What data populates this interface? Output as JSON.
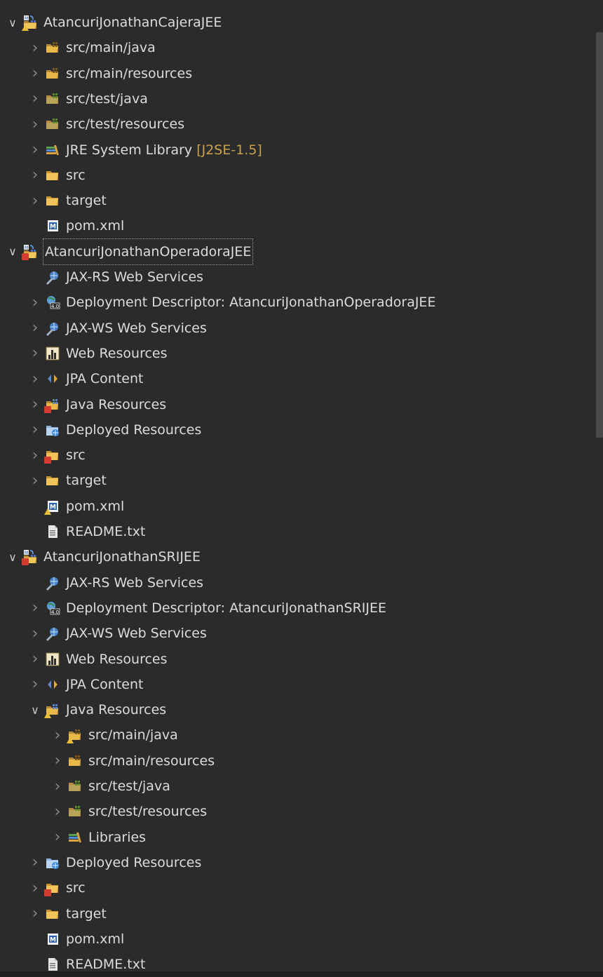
{
  "tree": {
    "nodes": [
      {
        "label": "AtancuriJonathanCajeraJEE",
        "state": "expanded",
        "icon": "maven-project-warning-icon",
        "focused": false
      },
      {
        "label": "src/main/java",
        "state": "collapsed",
        "icon": "source-folder-icon"
      },
      {
        "label": "src/main/resources",
        "state": "collapsed",
        "icon": "source-folder-icon"
      },
      {
        "label": "src/test/java",
        "state": "collapsed",
        "icon": "test-source-folder-icon"
      },
      {
        "label": "src/test/resources",
        "state": "collapsed",
        "icon": "test-source-folder-icon"
      },
      {
        "label": "JRE System Library",
        "decoration": "[J2SE-1.5]",
        "state": "collapsed",
        "icon": "library-icon"
      },
      {
        "label": "src",
        "state": "collapsed",
        "icon": "folder-icon"
      },
      {
        "label": "target",
        "state": "collapsed",
        "icon": "folder-icon"
      },
      {
        "label": "pom.xml",
        "state": "leaf",
        "icon": "maven-pom-icon"
      },
      {
        "label": "AtancuriJonathanOperadoraJEE",
        "state": "expanded",
        "icon": "maven-project-error-icon",
        "focused": true
      },
      {
        "label": "JAX-RS Web Services",
        "state": "leaf",
        "icon": "web-services-icon"
      },
      {
        "label": "Deployment Descriptor: AtancuriJonathanOperadoraJEE",
        "state": "collapsed",
        "icon": "deployment-descriptor-icon"
      },
      {
        "label": "JAX-WS Web Services",
        "state": "collapsed",
        "icon": "web-services-icon"
      },
      {
        "label": "Web Resources",
        "state": "collapsed",
        "icon": "web-resources-icon"
      },
      {
        "label": "JPA Content",
        "state": "collapsed",
        "icon": "jpa-content-icon"
      },
      {
        "label": "Java Resources",
        "state": "collapsed",
        "icon": "java-resources-error-icon"
      },
      {
        "label": "Deployed Resources",
        "state": "collapsed",
        "icon": "deployed-resources-icon"
      },
      {
        "label": "src",
        "state": "collapsed",
        "icon": "folder-error-icon"
      },
      {
        "label": "target",
        "state": "collapsed",
        "icon": "folder-icon"
      },
      {
        "label": "pom.xml",
        "state": "leaf",
        "icon": "maven-pom-warning-icon"
      },
      {
        "label": "README.txt",
        "state": "leaf",
        "icon": "text-file-icon"
      },
      {
        "label": "AtancuriJonathanSRIJEE",
        "state": "expanded",
        "icon": "maven-project-error-icon",
        "focused": false
      },
      {
        "label": "JAX-RS Web Services",
        "state": "leaf",
        "icon": "web-services-icon"
      },
      {
        "label": "Deployment Descriptor: AtancuriJonathanSRIJEE",
        "state": "collapsed",
        "icon": "deployment-descriptor-icon"
      },
      {
        "label": "JAX-WS Web Services",
        "state": "collapsed",
        "icon": "web-services-icon"
      },
      {
        "label": "Web Resources",
        "state": "collapsed",
        "icon": "web-resources-icon"
      },
      {
        "label": "JPA Content",
        "state": "collapsed",
        "icon": "jpa-content-icon"
      },
      {
        "label": "Java Resources",
        "state": "expanded",
        "icon": "java-resources-warning-icon"
      },
      {
        "label": "src/main/java",
        "state": "collapsed",
        "icon": "source-folder-warning-icon"
      },
      {
        "label": "src/main/resources",
        "state": "collapsed",
        "icon": "source-folder-icon"
      },
      {
        "label": "src/test/java",
        "state": "collapsed",
        "icon": "test-source-folder-icon"
      },
      {
        "label": "src/test/resources",
        "state": "collapsed",
        "icon": "test-source-folder-icon"
      },
      {
        "label": "Libraries",
        "state": "collapsed",
        "icon": "library-icon"
      },
      {
        "label": "Deployed Resources",
        "state": "collapsed",
        "icon": "deployed-resources-icon"
      },
      {
        "label": "src",
        "state": "collapsed",
        "icon": "folder-error-icon"
      },
      {
        "label": "target",
        "state": "collapsed",
        "icon": "folder-icon"
      },
      {
        "label": "pom.xml",
        "state": "leaf",
        "icon": "maven-pom-icon"
      },
      {
        "label": "README.txt",
        "state": "leaf",
        "icon": "text-file-icon"
      }
    ]
  },
  "colors": {
    "background": "#2b2b2b",
    "text": "#dcdcdc",
    "decoration": "#c9a24b",
    "arrow": "#8a8a8a",
    "error": "#d53b30",
    "warning": "#e9bf3a"
  }
}
